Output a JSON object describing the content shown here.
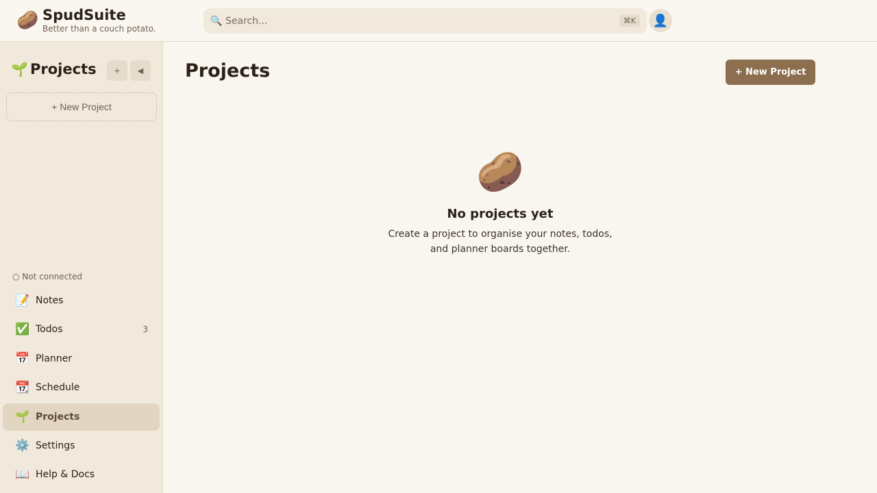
{
  "app": {
    "name": "SpudSuite",
    "tagline": "Better than a couch potato.",
    "logo_icon": "🥔"
  },
  "search": {
    "placeholder": "Search...",
    "shortcut": "⌘K",
    "icon": "🔍"
  },
  "user": {
    "avatar_icon": "👤"
  },
  "sidebar": {
    "title": "Projects",
    "title_icon": "🌱",
    "add_label": "+",
    "collapse_label": "◀",
    "new_project_label": "+ New Project",
    "connection_status": "○ Not connected",
    "nav": [
      {
        "icon": "📝",
        "label": "Notes",
        "count": ""
      },
      {
        "icon": "✅",
        "label": "Todos",
        "count": "3"
      },
      {
        "icon": "📅",
        "label": "Planner",
        "count": ""
      },
      {
        "icon": "📆",
        "label": "Schedule",
        "count": ""
      },
      {
        "icon": "🌱",
        "label": "Projects",
        "count": "",
        "active": true
      },
      {
        "icon": "⚙️",
        "label": "Settings",
        "count": ""
      },
      {
        "icon": "📖",
        "label": "Help & Docs",
        "count": ""
      }
    ]
  },
  "main": {
    "title": "Projects",
    "new_project_button": "+ New Project",
    "empty_state": {
      "icon": "🥔",
      "title": "No projects yet",
      "text": "Create a project to organise your notes, todos, and planner boards together."
    }
  },
  "colors": {
    "accent": "#8b6f4e",
    "background": "#f9f6f0",
    "sidebar": "#f1e9dc",
    "active_nav": "#e2d6c2"
  }
}
